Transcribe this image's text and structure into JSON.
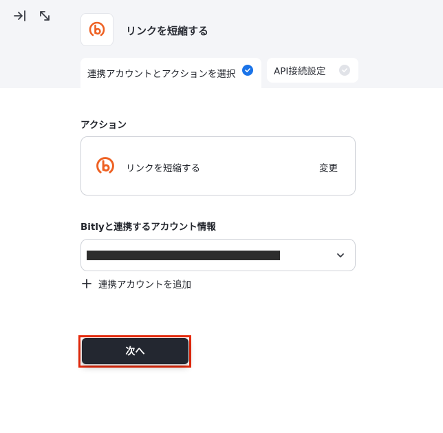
{
  "header": {
    "app_title": "リンクを短縮する",
    "tabs": [
      {
        "label": "連携アカウントとアクションを選択",
        "completed": true
      },
      {
        "label": "API接続設定",
        "completed": false
      }
    ]
  },
  "action_section": {
    "label": "アクション",
    "action_name": "リンクを短縮する",
    "change_label": "変更"
  },
  "account_section": {
    "label": "Bitlyと連携するアカウント情報",
    "selected_value": "",
    "add_account_label": "連携アカウントを追加"
  },
  "footer": {
    "next_label": "次へ"
  },
  "colors": {
    "brand_orange": "#ee6123",
    "check_blue": "#1a73e8",
    "button_dark": "#232730",
    "highlight_red": "#e8290b"
  },
  "icons": [
    "collapse-panel-icon",
    "expand-icon",
    "bitly-logo-icon",
    "check-circle-icon",
    "chevron-down-icon",
    "plus-icon"
  ]
}
